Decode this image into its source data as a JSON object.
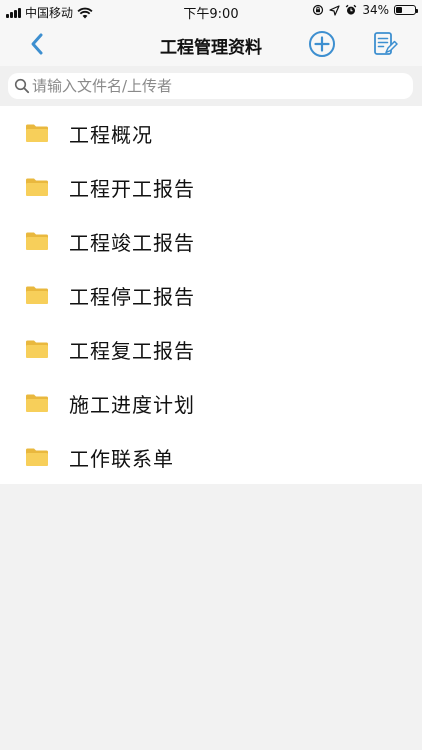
{
  "status": {
    "carrier": "中国移动",
    "time": "下午9:00",
    "battery_percent": "34%",
    "battery_level": 0.34
  },
  "nav": {
    "title": "工程管理资料"
  },
  "search": {
    "placeholder": "请输入文件名/上传者",
    "value": ""
  },
  "folders": [
    {
      "label": "工程概况"
    },
    {
      "label": "工程开工报告"
    },
    {
      "label": "工程竣工报告"
    },
    {
      "label": "工程停工报告"
    },
    {
      "label": "工程复工报告"
    },
    {
      "label": "施工进度计划"
    },
    {
      "label": "工作联系单"
    }
  ],
  "colors": {
    "accent": "#3d8fd0",
    "folder": "#f7cf5a",
    "background": "#f2f2f2"
  }
}
